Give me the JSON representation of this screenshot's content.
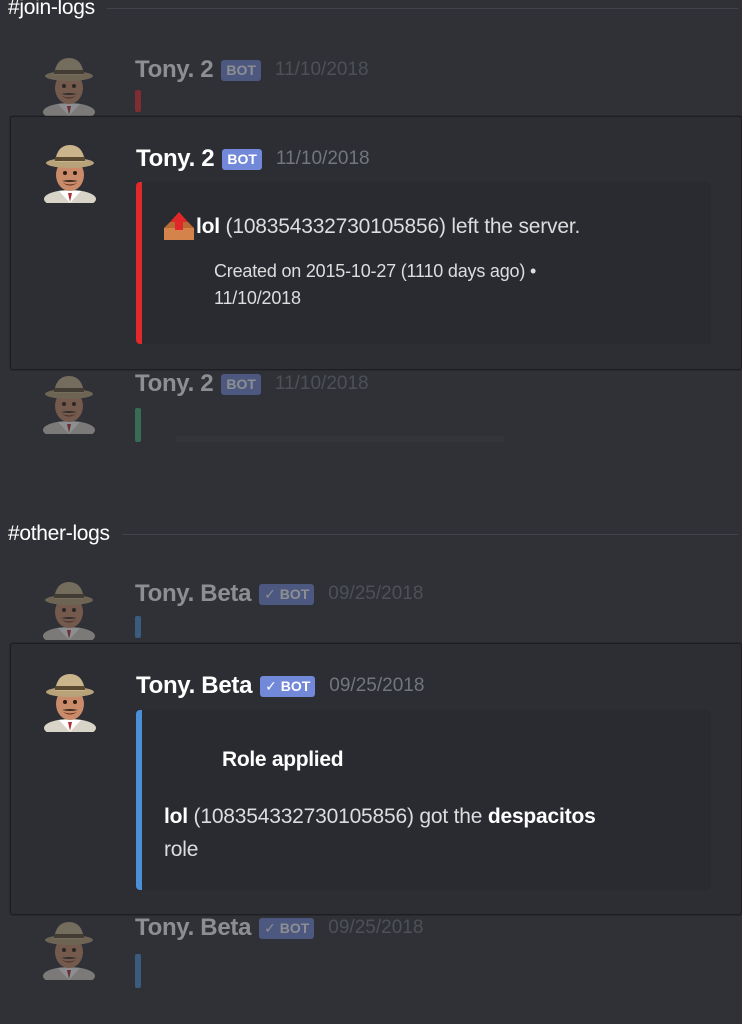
{
  "sections": [
    {
      "title": "#join-logs",
      "faded_top": {
        "username": "Tony. 2",
        "bot": "BOT",
        "timestamp": "11/10/2018",
        "color": "#e1292b"
      },
      "card": {
        "username": "Tony. 2",
        "bot": "BOT",
        "timestamp": "11/10/2018",
        "embed_color": "#e1292b",
        "icon": "outbox-tray-icon",
        "user": "lol",
        "description_rest": " (108354332730105856) left the server.",
        "footer_line1": "Created on 2015-10-27 (1110 days ago) •",
        "footer_line2": "11/10/2018"
      },
      "faded_bottom": {
        "username": "Tony. 2",
        "bot": "BOT",
        "timestamp": "11/10/2018",
        "color": "#43b581"
      }
    },
    {
      "title": "#other-logs",
      "faded_top": {
        "username": "Tony. Beta",
        "bot": "✓ BOT",
        "timestamp": "09/25/2018",
        "color": "#4a90d9"
      },
      "card": {
        "username": "Tony. Beta",
        "bot": "✓ BOT",
        "timestamp": "09/25/2018",
        "embed_color": "#4a90d9",
        "title": "Role applied",
        "user": "lol",
        "desc_mid": " (108354332730105856) got the ",
        "role": "despacitos",
        "desc_end": "role"
      },
      "faded_bottom": {
        "username": "Tony. Beta",
        "bot": "✓ BOT",
        "timestamp": "09/25/2018",
        "color": "#4a90d9"
      }
    }
  ]
}
